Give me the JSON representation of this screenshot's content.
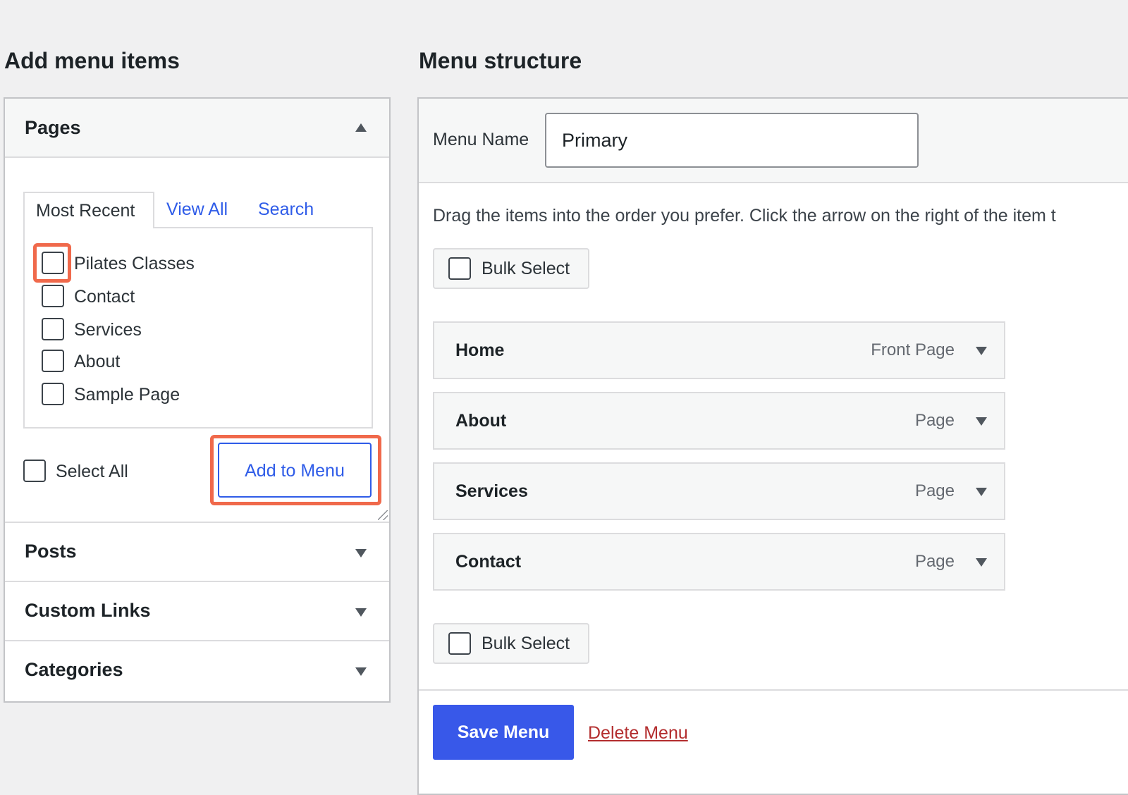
{
  "left": {
    "title": "Add menu items",
    "pages_section": {
      "title": "Pages",
      "tabs": [
        "Most Recent",
        "View All",
        "Search"
      ],
      "items": [
        "Pilates Classes",
        "Contact",
        "Services",
        "About",
        "Sample Page"
      ],
      "select_all_label": "Select All",
      "add_button_label": "Add to Menu"
    },
    "other_sections": [
      "Posts",
      "Custom Links",
      "Categories"
    ]
  },
  "right": {
    "title": "Menu structure",
    "menu_name_label": "Menu Name",
    "menu_name_value": "Primary",
    "instructions": "Drag the items into the order you prefer. Click the arrow on the right of the item t",
    "bulk_select_label": "Bulk Select",
    "menu_items": [
      {
        "title": "Home",
        "type": "Front Page"
      },
      {
        "title": "About",
        "type": "Page"
      },
      {
        "title": "Services",
        "type": "Page"
      },
      {
        "title": "Contact",
        "type": "Page"
      }
    ],
    "save_button_label": "Save Menu",
    "delete_link_label": "Delete Menu"
  },
  "colors": {
    "accent_blue": "#3858e9",
    "link_blue": "#2f5ce8",
    "delete_red": "#b32d2e",
    "highlight_orange": "#f0694b"
  }
}
